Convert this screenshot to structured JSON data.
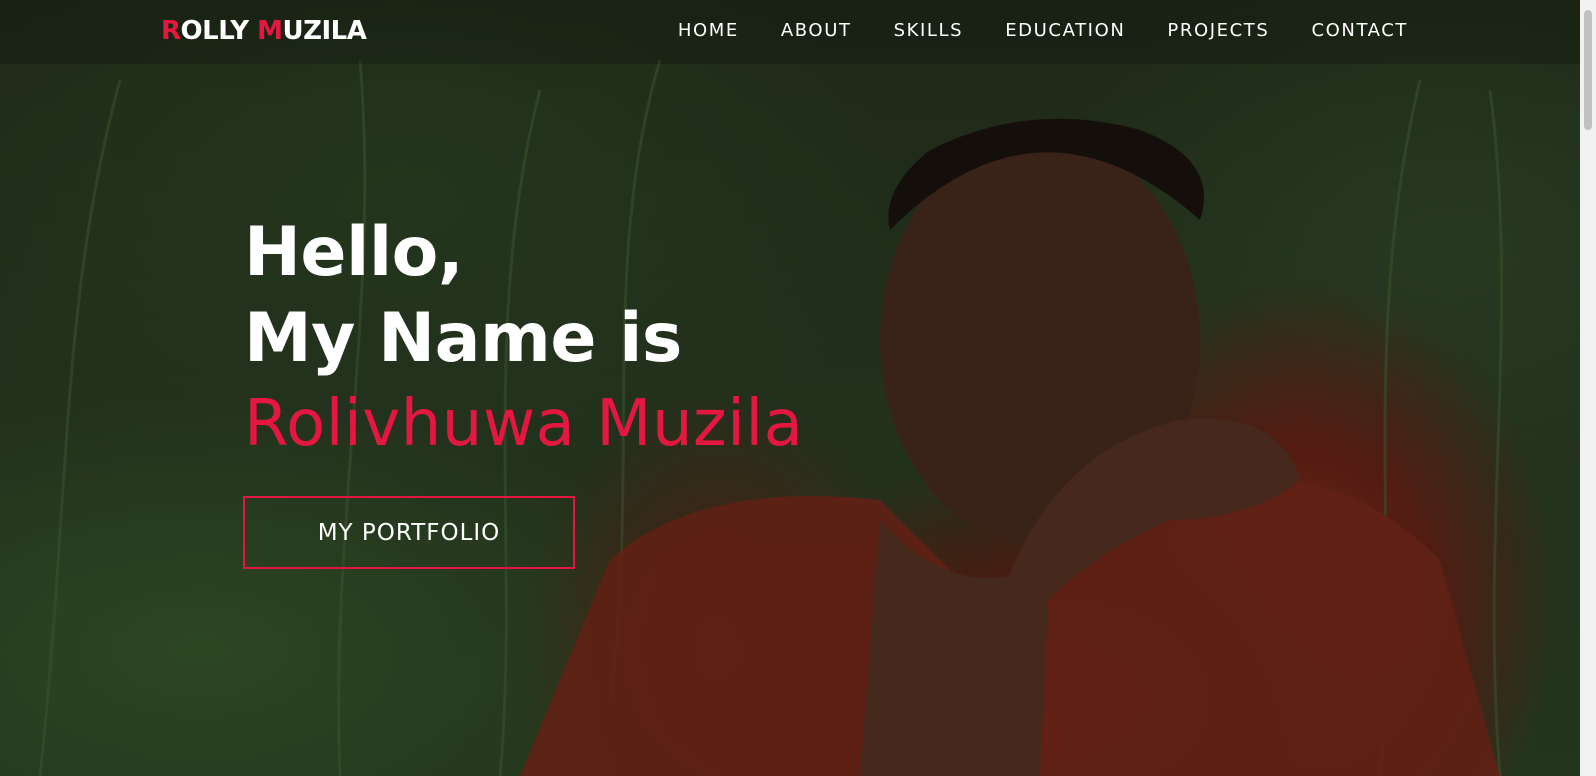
{
  "brand": {
    "logo_first_initial": "R",
    "logo_first_rest": "OLLY",
    "logo_last_initial": "M",
    "logo_last_rest": "UZILA",
    "accent_color": "#e3173f"
  },
  "nav": {
    "items": [
      {
        "label": "HOME"
      },
      {
        "label": "ABOUT"
      },
      {
        "label": "SKILLS"
      },
      {
        "label": "EDUCATION"
      },
      {
        "label": "PROJECTS"
      },
      {
        "label": "CONTACT"
      }
    ]
  },
  "hero": {
    "line1": "Hello,",
    "line2": "My Name is",
    "name": "Rolivhuwa Muzila",
    "cta_label": "MY PORTFOLIO"
  }
}
